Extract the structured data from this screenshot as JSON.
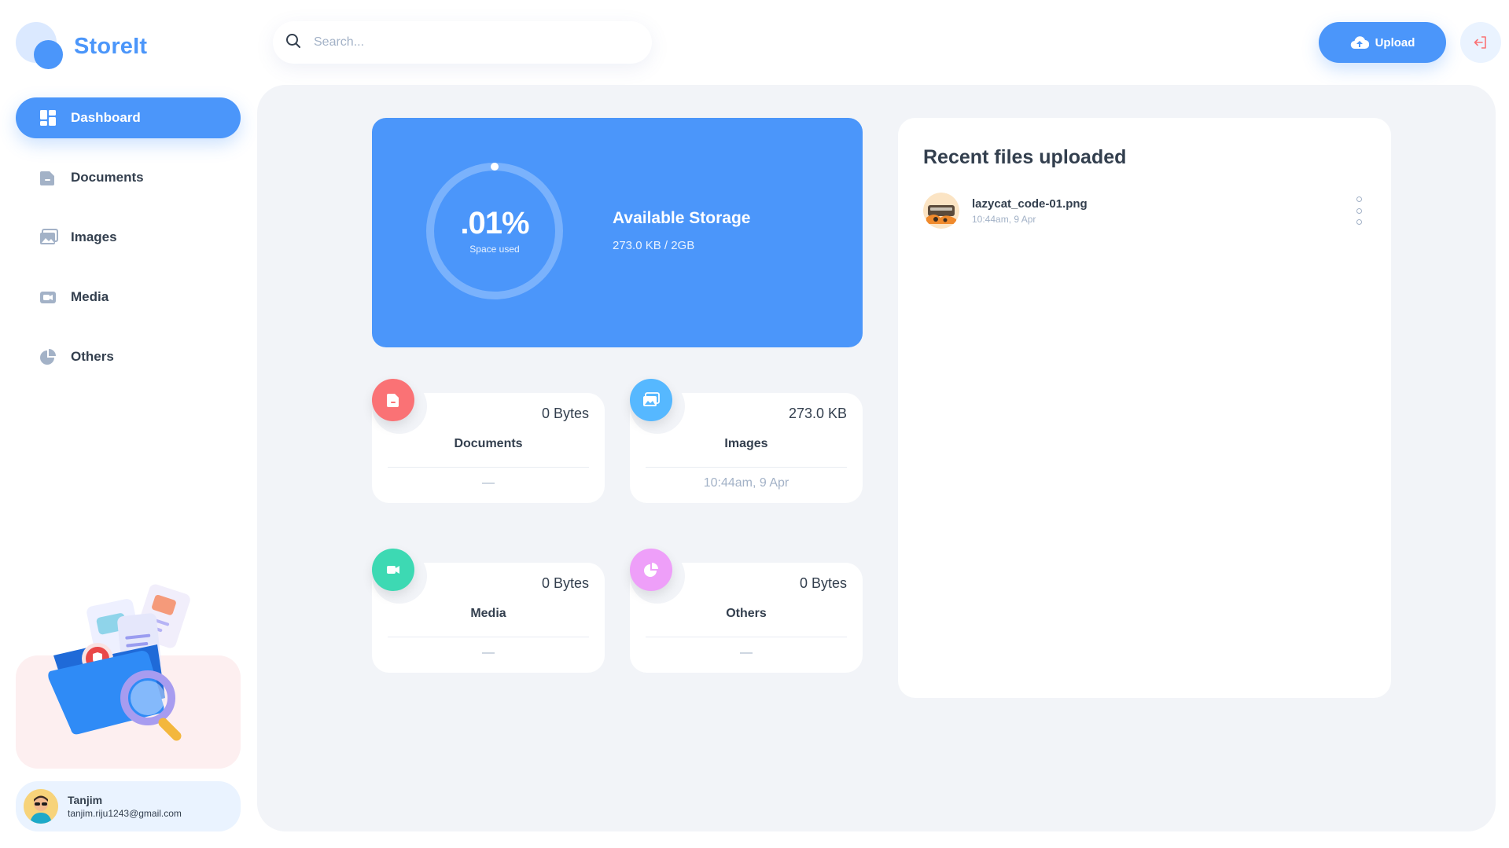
{
  "app": {
    "name": "StoreIt",
    "accent": "#4b96fa"
  },
  "sidebar": {
    "items": [
      {
        "label": "Dashboard",
        "icon": "dashboard-icon",
        "active": true
      },
      {
        "label": "Documents",
        "icon": "document-icon",
        "active": false
      },
      {
        "label": "Images",
        "icon": "image-icon",
        "active": false
      },
      {
        "label": "Media",
        "icon": "video-icon",
        "active": false
      },
      {
        "label": "Others",
        "icon": "pie-chart-icon",
        "active": false
      }
    ],
    "illustration": "files-folder-magnifier-illustration"
  },
  "user": {
    "name": "Tanjim",
    "email": "tanjim.riju1243@gmail.com"
  },
  "header": {
    "search_placeholder": "Search...",
    "upload_label": "Upload",
    "logout_icon": "logout-icon"
  },
  "storage": {
    "percent_label": ".01%",
    "percent_value": 0.01,
    "ring_caption": "Space used",
    "title": "Available Storage",
    "usage": "273.0 KB / 2GB"
  },
  "summary": [
    {
      "label": "Documents",
      "size": "0 Bytes",
      "date": "—",
      "icon": "document-icon",
      "color": "#fa7275"
    },
    {
      "label": "Images",
      "size": "273.0 KB",
      "date": "10:44am, 9 Apr",
      "icon": "image-icon",
      "color": "#56b8ff"
    },
    {
      "label": "Media",
      "size": "0 Bytes",
      "date": "—",
      "icon": "video-icon",
      "color": "#3dd9b3"
    },
    {
      "label": "Others",
      "size": "0 Bytes",
      "date": "—",
      "icon": "pie-chart-icon",
      "color": "#ee9ff9"
    }
  ],
  "recent": {
    "title": "Recent files uploaded",
    "files": [
      {
        "name": "lazycat_code-01.png",
        "time": "10:44am, 9 Apr"
      }
    ]
  }
}
